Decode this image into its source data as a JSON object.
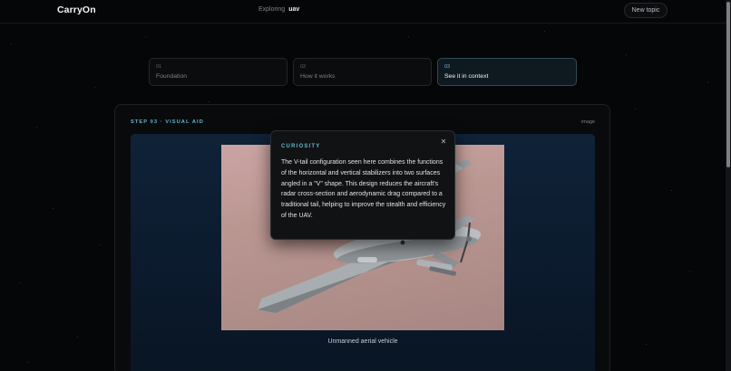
{
  "app": {
    "name": "CarryOn"
  },
  "header": {
    "exploring_label": "Exploring",
    "topic": "uav",
    "new_topic_label": "New topic"
  },
  "steps": [
    {
      "num": "01",
      "label": "Foundation",
      "active": false
    },
    {
      "num": "02",
      "label": "How it works",
      "active": false
    },
    {
      "num": "03",
      "label": "See it in context",
      "active": true
    }
  ],
  "card": {
    "title": "STEP 03 · VISUAL AID",
    "tag": "image",
    "caption": "Unmanned aerial vehicle"
  },
  "popover": {
    "title": "CURIOSITY",
    "close_icon": "close-icon",
    "body": "The V-tail configuration seen here combines the functions of the horizontal and vertical stabilizers into two surfaces angled in a \"V\" shape. This design reduces the aircraft's radar cross-section and aerodynamic drag compared to a traditional tail, helping to improve the stealth and efficiency of the UAV."
  },
  "colors": {
    "accent": "#5fb4d3",
    "background": "#050607"
  }
}
